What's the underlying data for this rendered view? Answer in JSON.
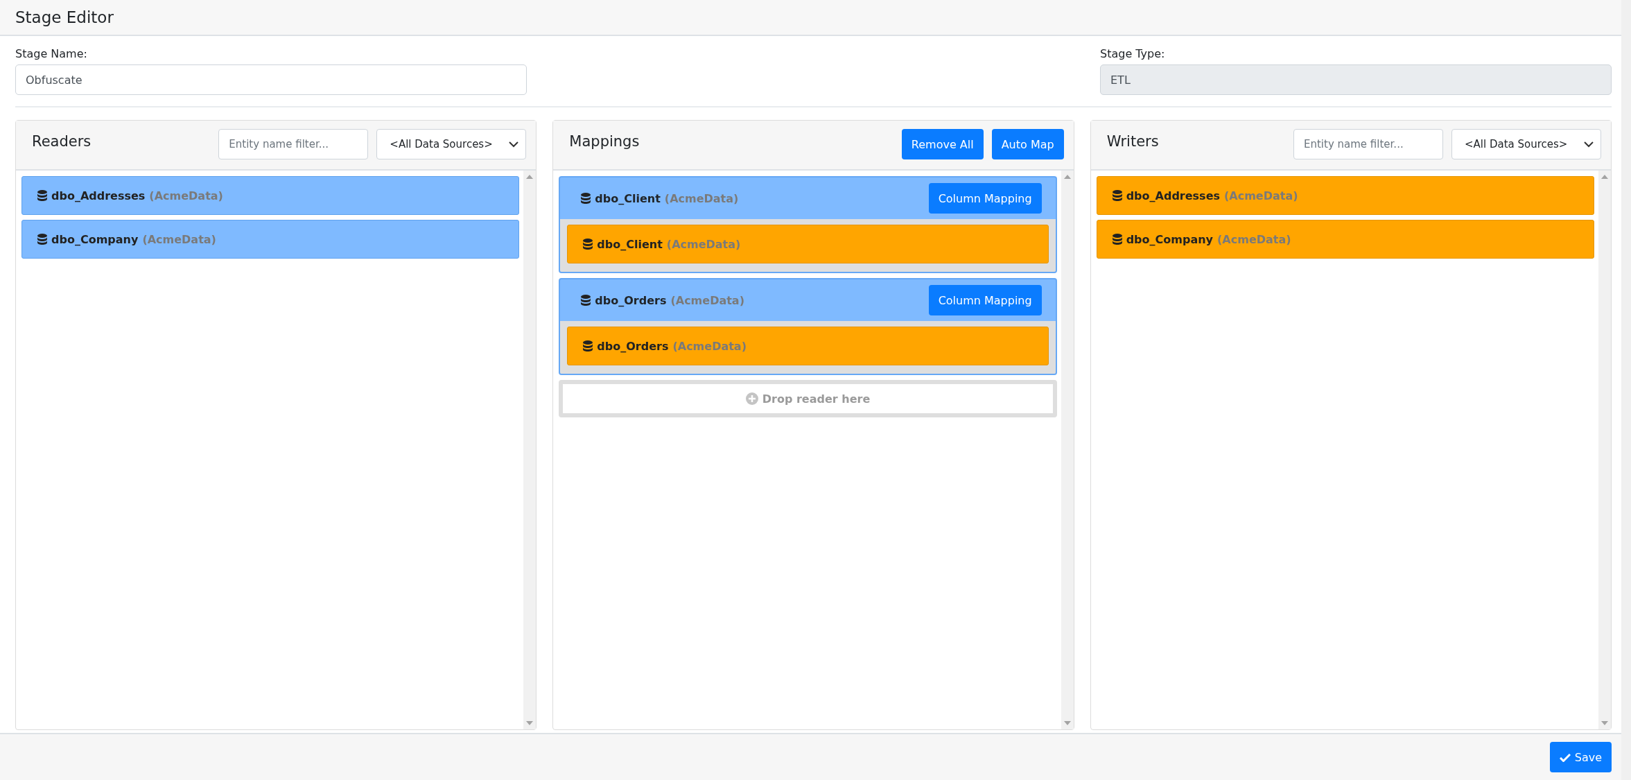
{
  "header": {
    "title": "Stage Editor"
  },
  "stage_name": {
    "label": "Stage Name:",
    "value": "Obfuscate"
  },
  "stage_type": {
    "label": "Stage Type:",
    "value": "ETL",
    "disabled": true
  },
  "readers": {
    "title": "Readers",
    "filter": {
      "placeholder": "Entity name filter..."
    },
    "source_select": {
      "value": "<All Data Sources>"
    },
    "items": [
      {
        "name": "dbo_Addresses",
        "source": "(AcmeData)"
      },
      {
        "name": "dbo_Company",
        "source": "(AcmeData)"
      }
    ]
  },
  "mappings": {
    "title": "Mappings",
    "buttons": [
      "Remove All",
      "Auto Map"
    ],
    "groups": [
      {
        "reader": {
          "name": "dbo_Client",
          "source": "(AcmeData)"
        },
        "button": "Column Mapping",
        "writer": {
          "name": "dbo_Client",
          "source": "(AcmeData)"
        }
      },
      {
        "reader": {
          "name": "dbo_Orders",
          "source": "(AcmeData)"
        },
        "button": "Column Mapping",
        "writer": {
          "name": "dbo_Orders",
          "source": "(AcmeData)"
        }
      }
    ],
    "drop_zone": "Drop reader here"
  },
  "writers": {
    "title": "Writers",
    "filter": {
      "placeholder": "Entity name filter..."
    },
    "source_select": {
      "value": "<All Data Sources>"
    },
    "items": [
      {
        "name": "dbo_Addresses",
        "source": "(AcmeData)"
      },
      {
        "name": "dbo_Company",
        "source": "(AcmeData)"
      }
    ]
  },
  "footer": {
    "save_button": "Save"
  }
}
